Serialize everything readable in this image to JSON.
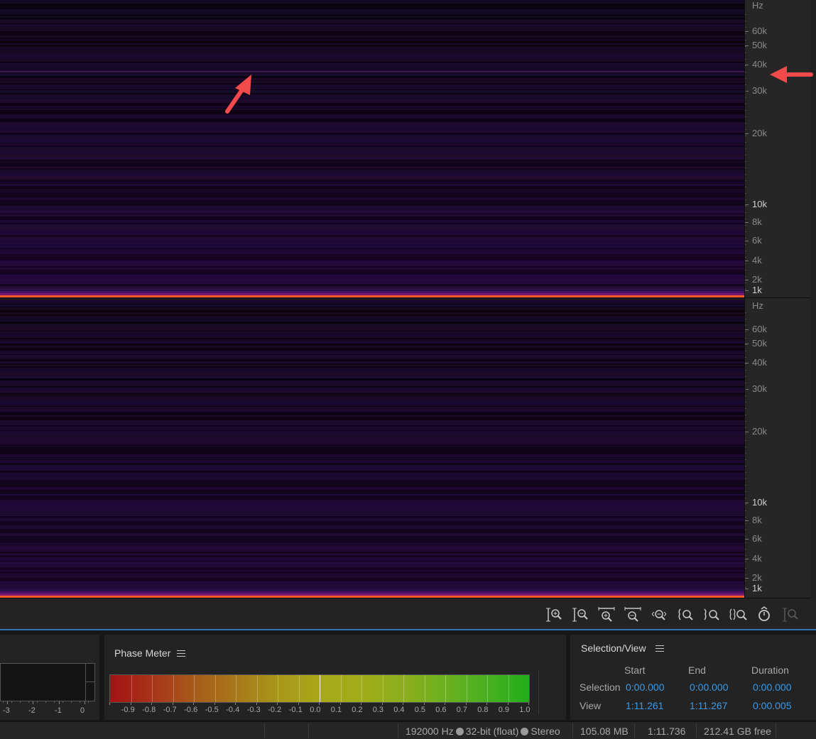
{
  "spectral": {
    "ruler_unit": "Hz",
    "ruler_labels": [
      "60k",
      "50k",
      "40k",
      "30k",
      "20k",
      "10k",
      "8k",
      "6k",
      "4k",
      "2k",
      "1k"
    ],
    "ruler_major": [
      "10k",
      "1k"
    ]
  },
  "zoom_toolbar": {
    "icons": [
      "zoom-in-amplitude-icon",
      "zoom-out-amplitude-icon",
      "zoom-in-full-icon",
      "zoom-out-full-icon",
      "zoom-selection-icon",
      "zoom-in-left-icon",
      "zoom-in-right-icon",
      "zoom-both-icon",
      "zoom-reset-icon",
      "zoom-spectral-icon"
    ]
  },
  "level_meter": {
    "scale": [
      "-3",
      "-2",
      "-1",
      "0"
    ]
  },
  "phase_meter": {
    "title": "Phase Meter",
    "scale": [
      "-0.9",
      "-0.8",
      "-0.7",
      "-0.6",
      "-0.5",
      "-0.4",
      "-0.3",
      "-0.2",
      "-0.1",
      "0.0",
      "0.1",
      "0.2",
      "0.3",
      "0.4",
      "0.5",
      "0.6",
      "0.7",
      "0.8",
      "0.9",
      "1.0"
    ]
  },
  "selection_view": {
    "title": "Selection/View",
    "col_start": "Start",
    "col_end": "End",
    "col_duration": "Duration",
    "row_selection": "Selection",
    "row_view": "View",
    "selection_start": "0:00.000",
    "selection_end": "0:00.000",
    "selection_duration": "0:00.000",
    "view_start": "1:11.261",
    "view_end": "1:11.267",
    "view_duration": "0:00.005"
  },
  "status_bar": {
    "sample_rate": "192000 Hz",
    "bit_depth": "32-bit (float)",
    "channels": "Stereo",
    "file_size": "105.08 MB",
    "duration": "1:11.736",
    "disk_free": "212.41 GB free"
  },
  "colors": {
    "accent_blue": "#3a9ae8",
    "annotation_red": "#f04a4a",
    "tone_orange": "#ff5a2a"
  }
}
